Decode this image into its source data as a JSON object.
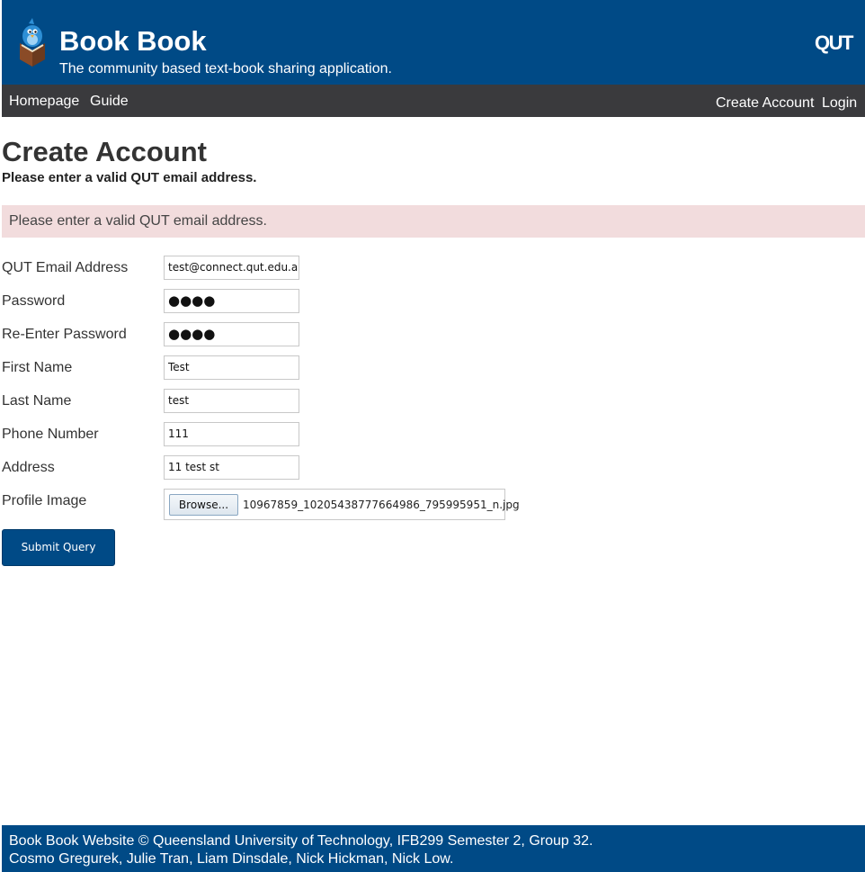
{
  "header": {
    "title": "Book Book",
    "tagline": "The community based text-book sharing application.",
    "institution_logo": "QUT",
    "logo_icon": "book-mascot-icon",
    "brand_color": "#004a86"
  },
  "nav": {
    "left": [
      "Homepage",
      "Guide"
    ],
    "right": [
      "Create Account",
      "Login"
    ],
    "background": "#3a3a3d"
  },
  "main": {
    "title": "Create Account",
    "subtitle": "Please enter a valid QUT email address.",
    "alert": {
      "text": "Please enter a valid QUT email address.",
      "background": "#f2dcdd"
    }
  },
  "form": {
    "fields": [
      {
        "label": "QUT Email Address",
        "value": "test@connect.qut.edu.au",
        "type": "text"
      },
      {
        "label": "Password",
        "value": "●●●●",
        "type": "password"
      },
      {
        "label": "Re-Enter Password",
        "value": "●●●●",
        "type": "password"
      },
      {
        "label": "First Name",
        "value": "Test",
        "type": "text"
      },
      {
        "label": "Last Name",
        "value": "test",
        "type": "text"
      },
      {
        "label": "Phone Number",
        "value": "111",
        "type": "text"
      },
      {
        "label": "Address",
        "value": "11 test st",
        "type": "text"
      }
    ],
    "profile_image": {
      "label": "Profile Image",
      "browse_label": "Browse...",
      "file_name": "10967859_10205438777664986_795995951_n.jpg"
    },
    "submit_label": "Submit Query"
  },
  "footer": {
    "line1": "Book Book Website © Queensland University of Technology, IFB299 Semester 2, Group 32.",
    "line2": "Cosmo Gregurek, Julie Tran, Liam Dinsdale, Nick Hickman, Nick Low."
  }
}
